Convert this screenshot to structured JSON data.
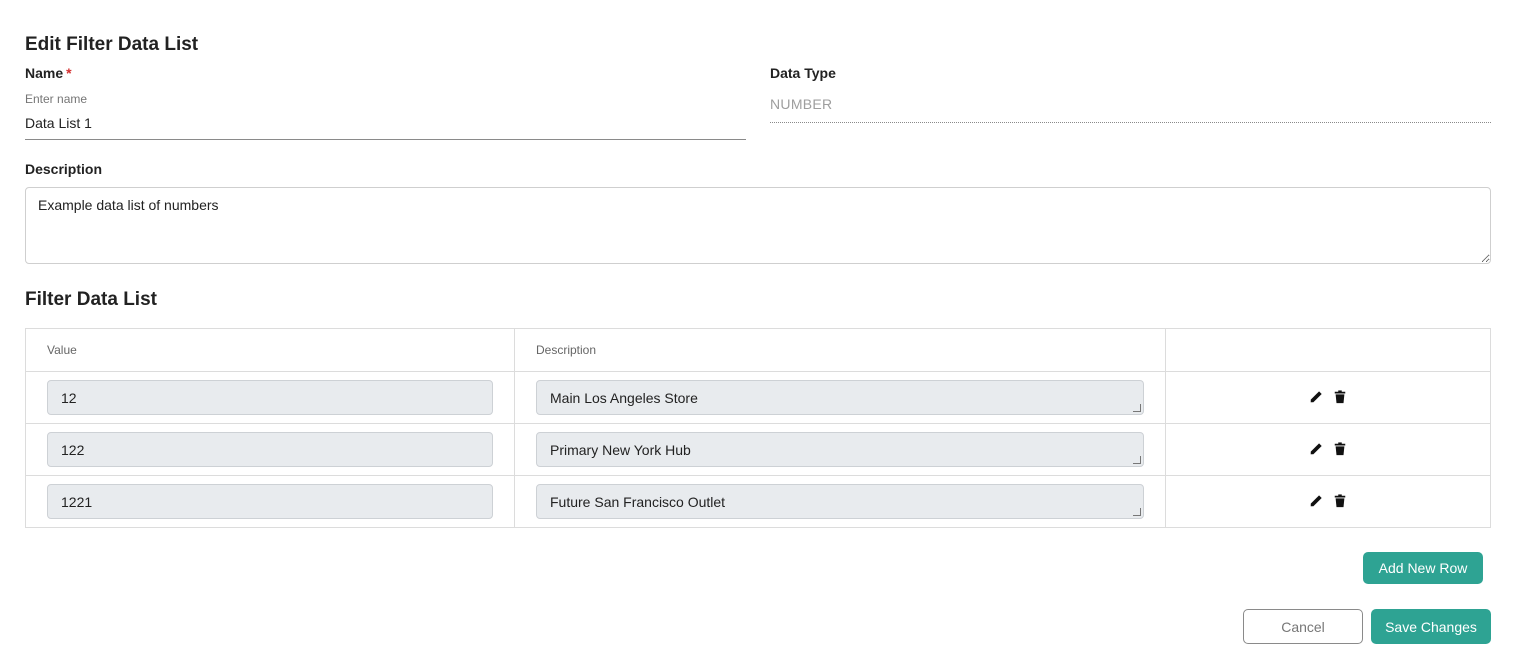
{
  "page": {
    "title": "Edit Filter Data List"
  },
  "form": {
    "name_label": "Name",
    "required_marker": "*",
    "name_placeholder": "Enter name",
    "name_value": "Data List 1",
    "data_type_label": "Data Type",
    "data_type_value": "NUMBER",
    "description_label": "Description",
    "description_value": "Example data list of numbers"
  },
  "filter_list": {
    "title": "Filter Data List",
    "columns": [
      "Value",
      "Description",
      ""
    ],
    "rows": [
      {
        "value": "12",
        "description": "Main Los Angeles Store"
      },
      {
        "value": "122",
        "description": "Primary New York Hub"
      },
      {
        "value": "1221",
        "description": "Future San Francisco Outlet"
      }
    ],
    "row_icons": [
      "pencil-icon",
      "trash-icon"
    ]
  },
  "buttons": {
    "add_row": "Add New Row",
    "cancel": "Cancel",
    "save": "Save Changes"
  },
  "colors": {
    "accent": "#2ea393",
    "required": "#d32f2f",
    "input_bg": "#e8ebee"
  }
}
